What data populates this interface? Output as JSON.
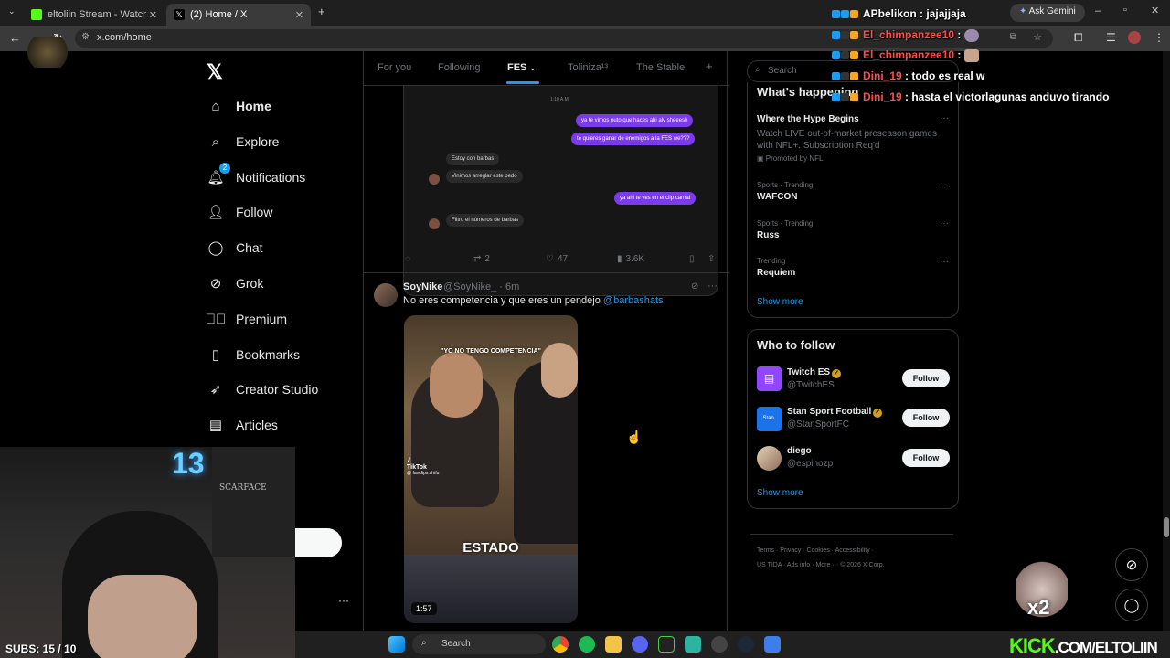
{
  "browser": {
    "tabs": [
      {
        "title": "eltoliin Stream - Watch Live on"
      },
      {
        "title": "(2) Home / X"
      }
    ],
    "url": "x.com/home",
    "ask_gemini": "Ask Gemini"
  },
  "sidebar": {
    "items": [
      {
        "label": "Home",
        "icon": "home-icon"
      },
      {
        "label": "Explore",
        "icon": "search-icon"
      },
      {
        "label": "Notifications",
        "icon": "bell-icon",
        "badge": "2"
      },
      {
        "label": "Follow",
        "icon": "add-person-icon"
      },
      {
        "label": "Chat",
        "icon": "chat-bubble-icon"
      },
      {
        "label": "Grok",
        "icon": "grok-icon"
      },
      {
        "label": "Premium",
        "icon": "premium-icon"
      },
      {
        "label": "Bookmarks",
        "icon": "bookmark-icon"
      },
      {
        "label": "Creator Studio",
        "icon": "rocket-icon"
      },
      {
        "label": "Articles",
        "icon": "article-icon"
      }
    ]
  },
  "feed_tabs": {
    "for_you": "For you",
    "following": "Following",
    "fes": "FES",
    "toliniza": "Toliniza¹³",
    "stable": "The Stable",
    "add": "+"
  },
  "chat_image": {
    "time": "1:10 A.M",
    "messages": [
      "ya te vimos puto que haces ahi alv sheeesh",
      "te quieres ganar de enemigos a la FES we???",
      "Estoy con barbas",
      "Vinimos arreglar este pedo",
      "ya ahi te ves en el clip carnal",
      "Filtro el números de barbas"
    ]
  },
  "tweet1_actions": {
    "replies": "",
    "reposts": "2",
    "likes": "47",
    "views": "3.6K"
  },
  "tweet2": {
    "name": "SoyNike",
    "handle": "@SoyNike_ · 6m",
    "text": "No eres competencia y que eres un pendejo ",
    "mention": "@barbashats",
    "video_caption_top": "\"YO NO TENGO COMPETENCIA\"",
    "video_caption_bottom": "ESTADO",
    "tiktok": "TikTok",
    "tiktok_user": "@ fanclips.shifu",
    "duration": "1:57"
  },
  "right": {
    "search_placeholder": "Search",
    "whats_happening": "What's happening",
    "trends": [
      {
        "title": "Where the Hype Begins",
        "desc": "Watch LIVE out-of-market preseason games with NFL+. Subscription Req'd",
        "promo": "Promoted by NFL"
      },
      {
        "sub": "Sports · Trending",
        "title": "WAFCON"
      },
      {
        "sub": "Sports · Trending",
        "title": "Russ"
      },
      {
        "sub": "Trending",
        "title": "Requiem"
      }
    ],
    "show_more": "Show more",
    "who_to_follow": "Who to follow",
    "follows": [
      {
        "name": "Twitch ES",
        "handle": "@TwitchES",
        "button": "Follow"
      },
      {
        "name": "Stan Sport Football",
        "handle": "@StanSportFC",
        "button": "Follow"
      },
      {
        "name": "diego",
        "handle": "@espinozp",
        "button": "Follow"
      }
    ],
    "show_more2": "Show more",
    "footer1": "Terms ·   Privacy ·   Cookies ·   Accessibility ·",
    "footer2": "US TIDA ·   Ads info ·   More ···   © 2026 X Corp."
  },
  "stream_chat": [
    {
      "user": "APbelikon",
      "msg": " : jajajjaja",
      "color": "white"
    },
    {
      "user": "El_chimpanzee10",
      "msg": " :",
      "color": "red"
    },
    {
      "user": "El_chimpanzee10",
      "msg": " :",
      "color": "red"
    },
    {
      "user": "Dini_19",
      "msg": " : todo es real w",
      "color": "red"
    },
    {
      "user": "Dini_19",
      "msg": " : hasta el victorlagunas anduvo tirando",
      "color": "red"
    }
  ],
  "stream": {
    "subs": "SUBS: 15 / 10",
    "neon": "13",
    "poster": "SCARFACE",
    "x2": "x2",
    "kick": "KICK",
    "kick_url": ".COM/ELTOLIIN"
  },
  "taskbar": {
    "search": "Search"
  },
  "colors": {
    "accent": "#1d9bf0",
    "chat_purple": "#7c3aed",
    "kick_green": "#53fc18"
  }
}
